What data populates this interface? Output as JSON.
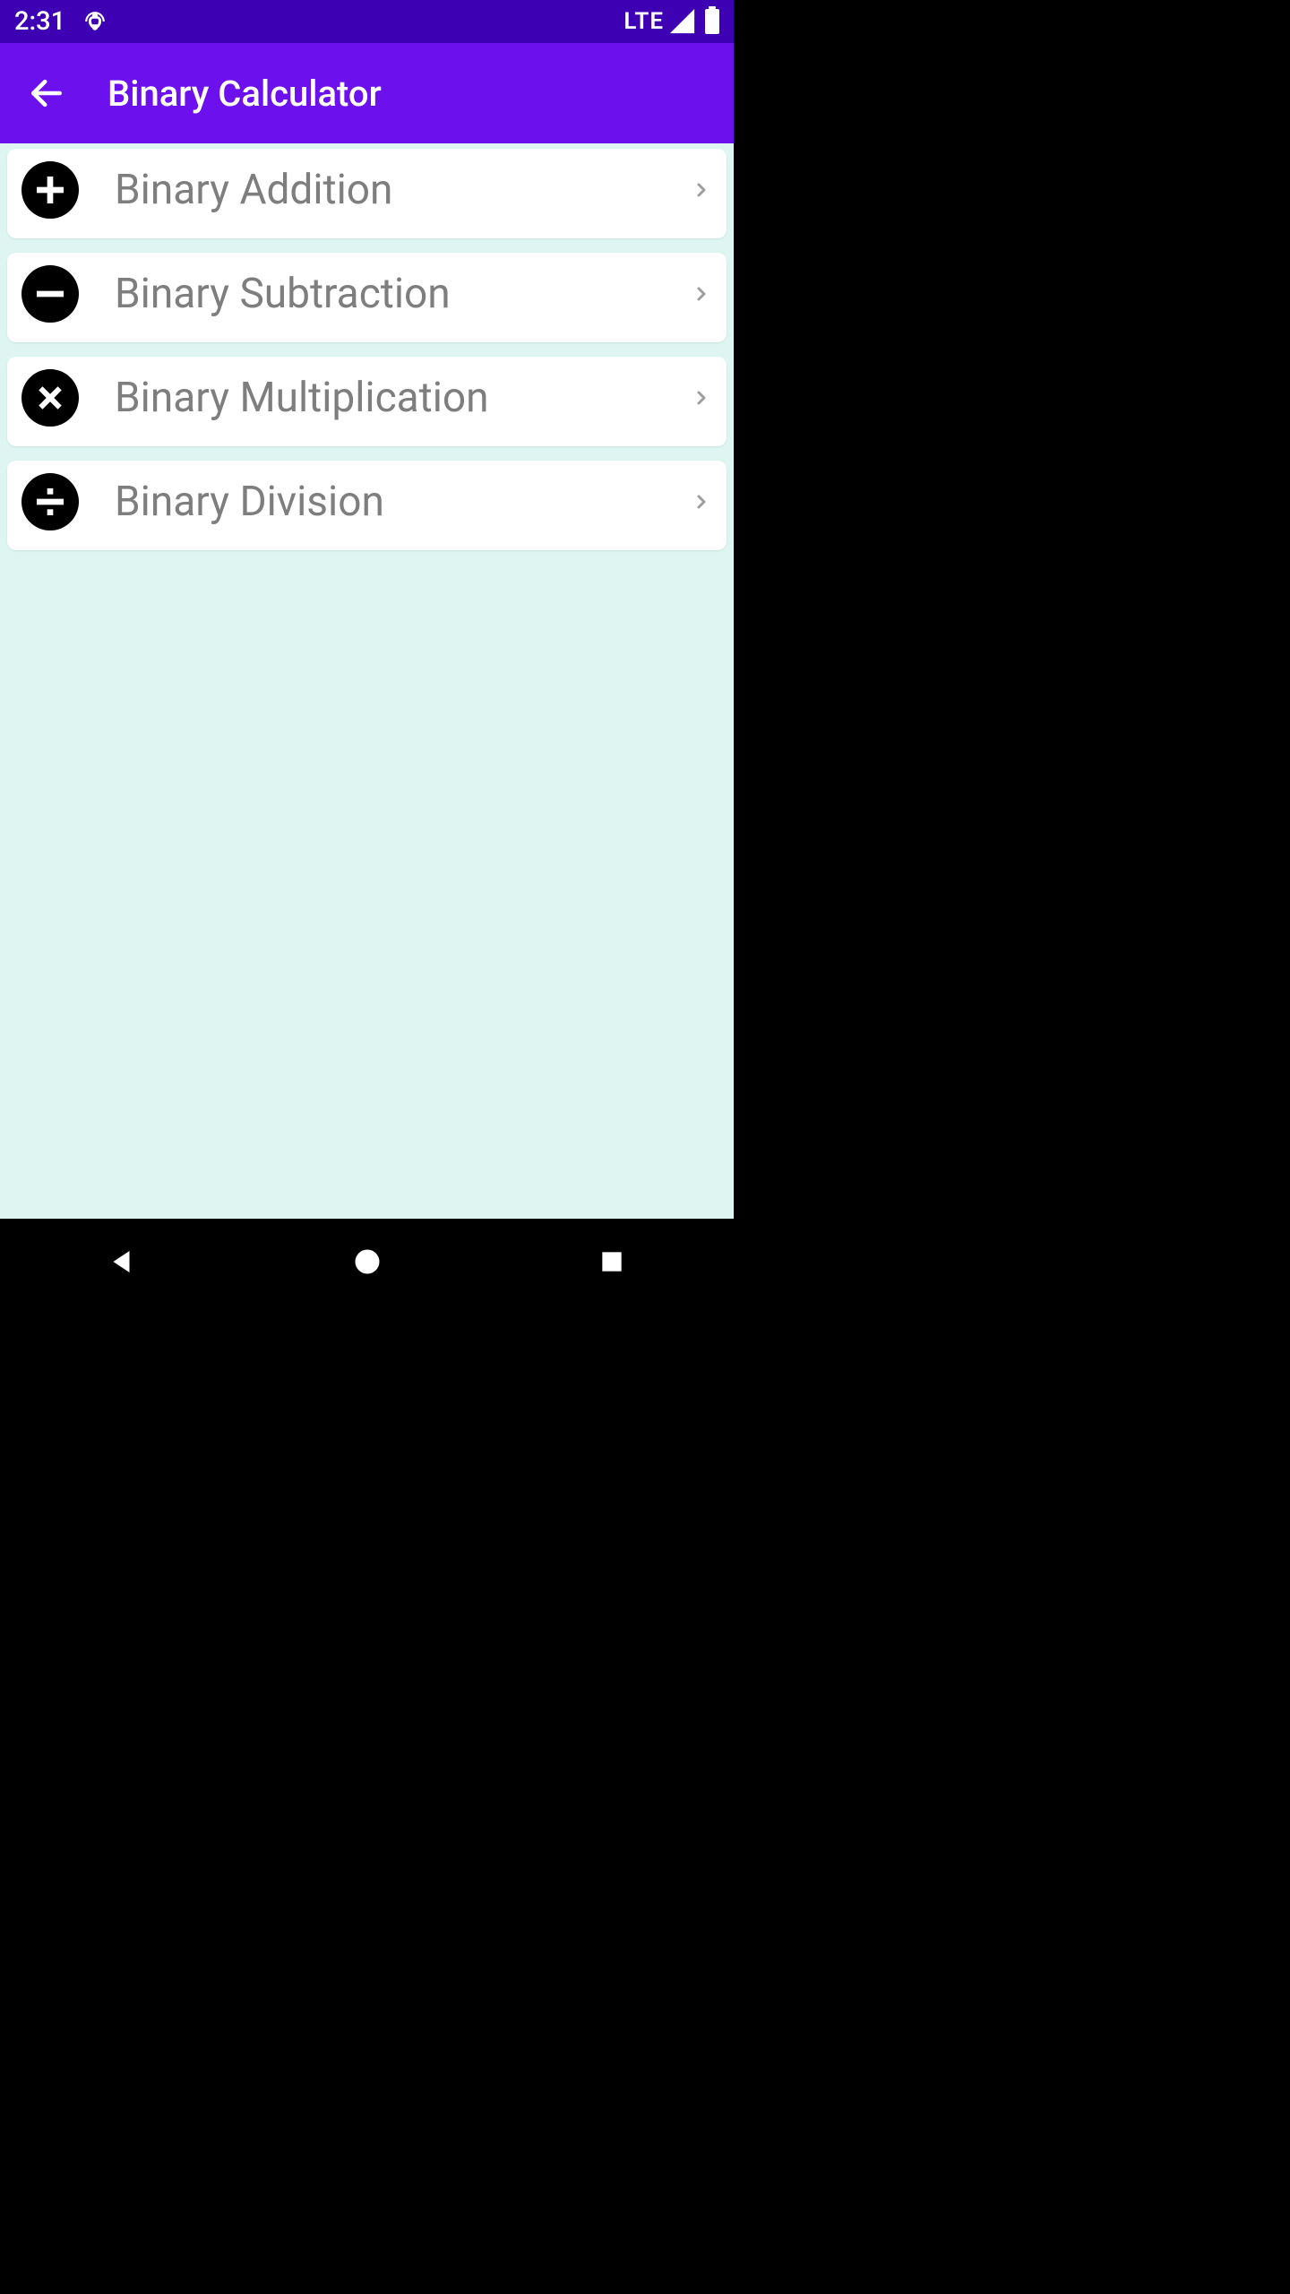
{
  "status_bar": {
    "time": "2:31",
    "lte_label": "LTE"
  },
  "app_bar": {
    "title": "Binary Calculator"
  },
  "list": {
    "items": [
      {
        "label": "Binary Addition",
        "icon": "plus-icon"
      },
      {
        "label": "Binary Subtraction",
        "icon": "minus-icon"
      },
      {
        "label": "Binary Multiplication",
        "icon": "multiply-icon"
      },
      {
        "label": "Binary Division",
        "icon": "divide-icon"
      }
    ]
  },
  "colors": {
    "status_bar": "#3E00B3",
    "app_bar": "#6D10EE",
    "content_bg": "#DEF5F1",
    "item_text": "#7E7E7E",
    "icon_bg": "#000000"
  }
}
